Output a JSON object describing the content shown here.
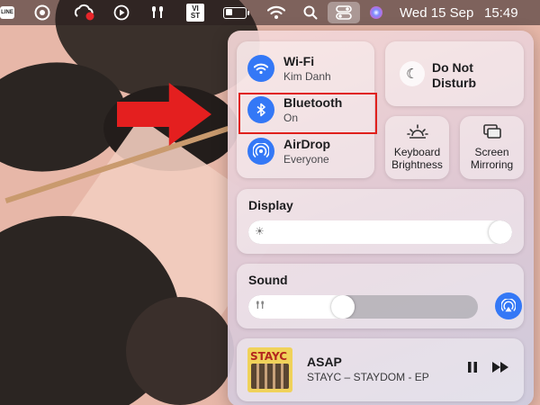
{
  "menubar": {
    "line_label": "LINE",
    "vist_label": "VI\nST",
    "date": "Wed 15 Sep",
    "time": "15:49"
  },
  "control_center": {
    "wifi": {
      "title": "Wi-Fi",
      "subtitle": "Kim Danh"
    },
    "bluetooth": {
      "title": "Bluetooth",
      "subtitle": "On"
    },
    "airdrop": {
      "title": "AirDrop",
      "subtitle": "Everyone"
    },
    "dnd": {
      "label": "Do Not\nDisturb"
    },
    "keyboard": {
      "label": "Keyboard\nBrightness"
    },
    "screen_mirroring": {
      "label": "Screen\nMirroring"
    },
    "display": {
      "title": "Display",
      "level": 1.0
    },
    "sound": {
      "title": "Sound",
      "level": 0.4
    },
    "now_playing": {
      "song": "ASAP",
      "artist": "STAYC – STAYDOM - EP",
      "album_logo": "STAYC"
    }
  },
  "colors": {
    "accent": "#3478f6",
    "highlight": "#e0201c",
    "arrow": "#e41f1f"
  },
  "icons": [
    "line-icon",
    "record-icon",
    "creative-cloud-icon",
    "play-icon",
    "airpods-icon",
    "vist-icon",
    "battery-icon",
    "wifi-icon",
    "search-icon",
    "control-center-icon",
    "siri-icon",
    "bluetooth-icon",
    "airdrop-icon",
    "moon-icon",
    "keyboard-brightness-icon",
    "screen-mirroring-icon",
    "sun-icon",
    "airpods-sound-icon",
    "airplay-icon",
    "pause-icon",
    "forward-icon"
  ]
}
